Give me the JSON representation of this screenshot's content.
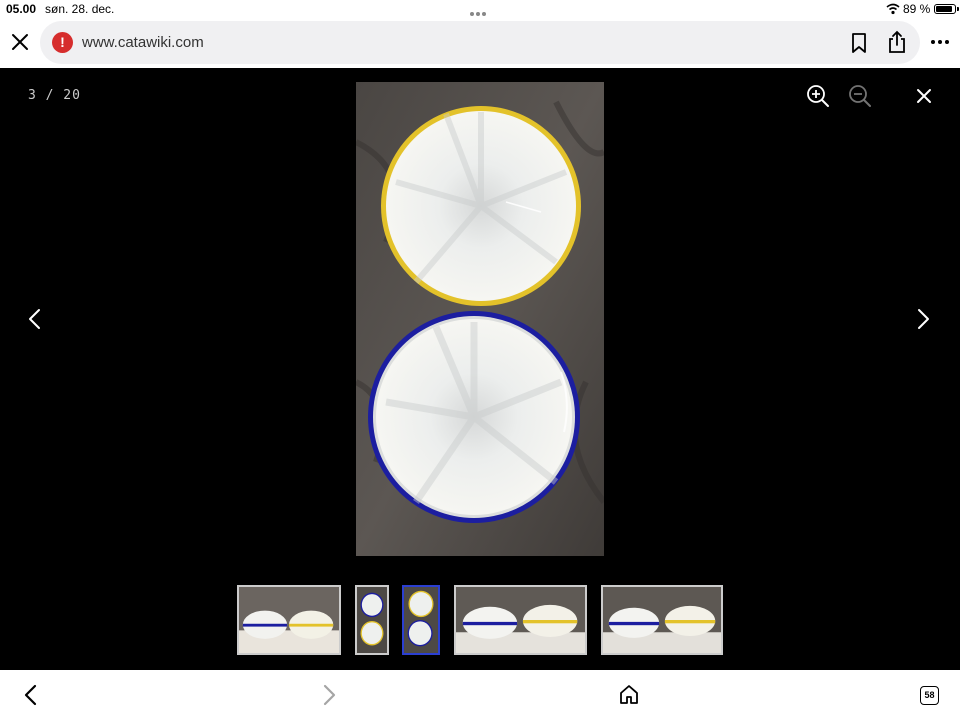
{
  "status": {
    "time": "05.00",
    "date": "søn. 28. dec.",
    "battery_percent": "89 %"
  },
  "browser": {
    "url": "www.catawiki.com"
  },
  "viewer": {
    "counter": "3 / 20",
    "thumbnails": [
      {
        "name": "thumb-1",
        "active": false
      },
      {
        "name": "thumb-2",
        "active": false
      },
      {
        "name": "thumb-3",
        "active": true
      },
      {
        "name": "thumb-4",
        "active": false
      },
      {
        "name": "thumb-5",
        "active": false
      }
    ]
  },
  "toolbar": {
    "tab_count": "58"
  },
  "colors": {
    "accent": "#2b3fd1",
    "yellow_rim": "#e3c22a",
    "blue_rim": "#1c1ea0",
    "warning": "#d62d2d"
  },
  "icons": [
    "close-icon",
    "warning-icon",
    "bookmark-icon",
    "share-icon",
    "more-icon",
    "zoom-in-icon",
    "zoom-out-icon",
    "prev-icon",
    "next-icon",
    "back-icon",
    "forward-icon",
    "home-icon",
    "tabs-icon"
  ]
}
